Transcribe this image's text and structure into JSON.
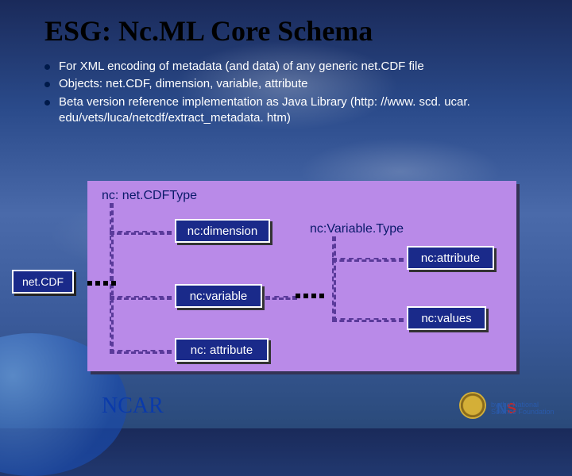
{
  "title": "ESG: Nc.ML Core Schema",
  "bullets": [
    "For XML encoding of metadata (and data) of any generic net.CDF file",
    "Objects: net.CDF, dimension, variable, attribute",
    "Beta version reference implementation as Java Library (http: //www. scd. ucar. edu/vets/luca/netcdf/extract_metadata. htm)"
  ],
  "diagram": {
    "root_type": "nc: net.CDFType",
    "root_box": "net.CDF",
    "children": {
      "dimension": "nc:dimension",
      "variable": "nc:variable",
      "attribute": "nc: attribute"
    },
    "variable_type_label": "nc:Variable.Type",
    "variable_children": {
      "attribute": "nc:attribute",
      "values": "nc:values"
    }
  },
  "footer": {
    "ncar": "NCAR",
    "nsf_text": "by the National Science Foundation"
  }
}
